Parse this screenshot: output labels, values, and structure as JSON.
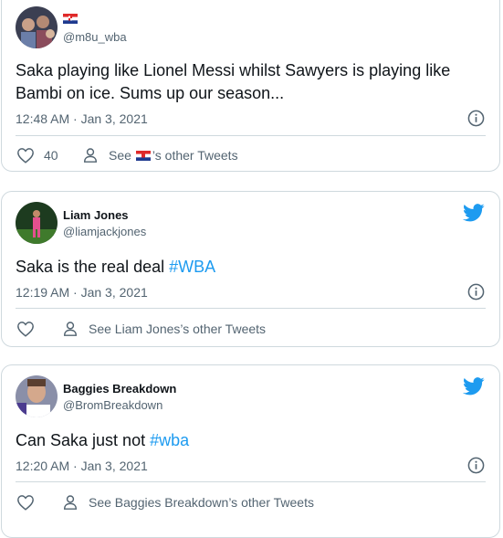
{
  "tweets": [
    {
      "name": "",
      "handle": "@m8u_wba",
      "text": "Saka playing like Lionel Messi whilst Sawyers is playing like Bambi on ice. Sums up our season...",
      "text_line1": "Saka playing like Lionel Messi whilst Sawyers is playing like",
      "text_line2": "Bambi on ice. Sums up our season...",
      "time": "12:48 AM · Jan 3, 2021",
      "likes": "40",
      "see_prefix": "See",
      "see_suffix": "’s other Tweets"
    },
    {
      "name": "Liam Jones",
      "handle": "@liamjackjones",
      "text_plain": "Saka is the real deal ",
      "hashtag": "#WBA",
      "time": "12:19 AM · Jan 3, 2021",
      "see_label": "See Liam Jones’s other Tweets"
    },
    {
      "name": "Baggies Breakdown",
      "handle": "@BromBreakdown",
      "text_plain": "Can Saka just not ",
      "hashtag": "#wba",
      "time": "12:20 AM · Jan 3, 2021",
      "see_label": "See Baggies Breakdown’s other Tweets"
    }
  ],
  "colors": {
    "accent": "#1d9bf0",
    "secondary_text": "#536471",
    "border": "#cfd9de"
  },
  "icons": [
    "twitter-bird-icon",
    "info-icon",
    "heart-icon",
    "person-icon",
    "croatia-flag-icon"
  ]
}
